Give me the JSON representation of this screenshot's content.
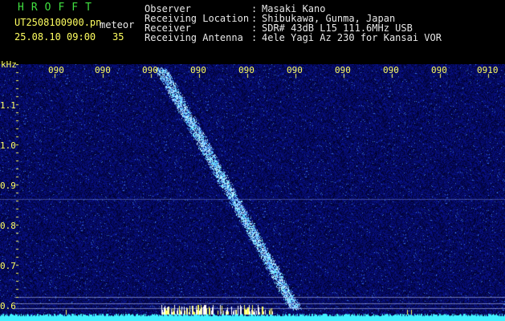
{
  "logo": "HROFFT",
  "file": {
    "name": "UT2508100900.pn",
    "tag": "meteor",
    "datetime": "25.08.10 09:00",
    "count": "35"
  },
  "info": {
    "labels": [
      "Observer",
      "Receiving Location",
      "Receiver",
      "Receiving Antenna"
    ],
    "sep": ":",
    "values": [
      "Masaki Kano",
      "Shibukawa, Gunma, Japan",
      "SDR# 43dB L15 111.6MHz USB",
      "4ele Yagi Az 230 for Kansai VOR"
    ]
  },
  "axis": {
    "unit": "kHz",
    "y_ticks": [
      "1.1",
      "1.0",
      "0.9",
      "0.8",
      "0.7",
      "0.6"
    ],
    "x_ticks": [
      "090",
      "090",
      "090",
      "090",
      "090",
      "090",
      "090",
      "090",
      "090",
      "0910"
    ]
  },
  "colors": {
    "background": "#000000",
    "noise": "#0a1680",
    "signal": "#a8f4ff",
    "labels": "#ffff60",
    "baseline": "#40f0ff"
  }
}
